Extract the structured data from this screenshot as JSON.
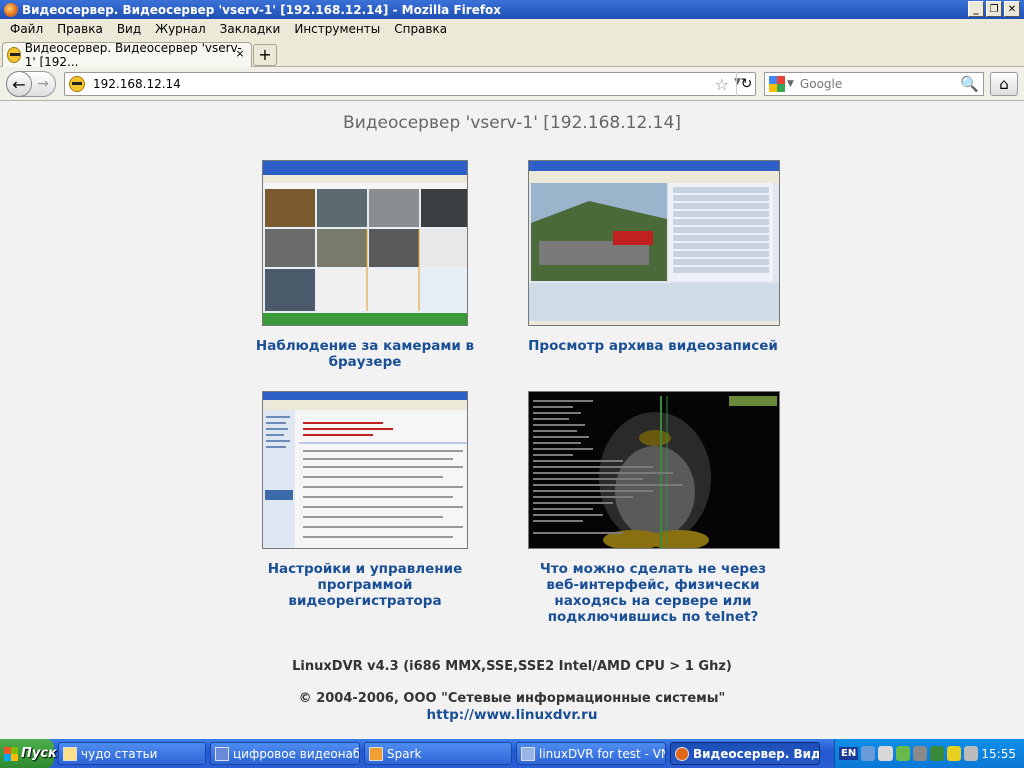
{
  "window": {
    "title": "Видеосервер. Видеосервер 'vserv-1' [192.168.12.14] - Mozilla Firefox"
  },
  "menu": [
    "Файл",
    "Правка",
    "Вид",
    "Журнал",
    "Закладки",
    "Инструменты",
    "Справка"
  ],
  "tab": {
    "label": "Видеосервер. Видеосервер 'vserv-1' [192...",
    "close": "×",
    "new_tab": "+"
  },
  "nav": {
    "url": "192.168.12.14",
    "search_placeholder": "Google"
  },
  "page": {
    "title": "Видеосервер 'vserv-1' [192.168.12.14]",
    "items": [
      {
        "caption": "Наблюдение за камерами в браузере"
      },
      {
        "caption": "Просмотр архива видеозаписей"
      },
      {
        "caption": "Настройки и управление программой видеорегистратора"
      },
      {
        "caption": "Что можно сделать не через веб-интерфейс, физически находясь на сервере или подключившись по telnet?"
      }
    ],
    "footer_version": "LinuxDVR v4.3 (i686 MMX,SSE,SSE2 Intel/AMD CPU > 1 Ghz)",
    "footer_copyright": "© 2004-2006, ООО \"Сетевые информационные системы\"",
    "footer_link": "http://www.linuxdvr.ru"
  },
  "taskbar": {
    "start": "Пуск",
    "tasks": [
      {
        "label": "чудо статьи"
      },
      {
        "label": "цифровое видеонабл..."
      },
      {
        "label": "Spark"
      },
      {
        "label": "linuxDVR for test - VM..."
      },
      {
        "label": "Видеосервер. Виде..."
      }
    ],
    "lang": "EN",
    "clock": "15:55"
  }
}
